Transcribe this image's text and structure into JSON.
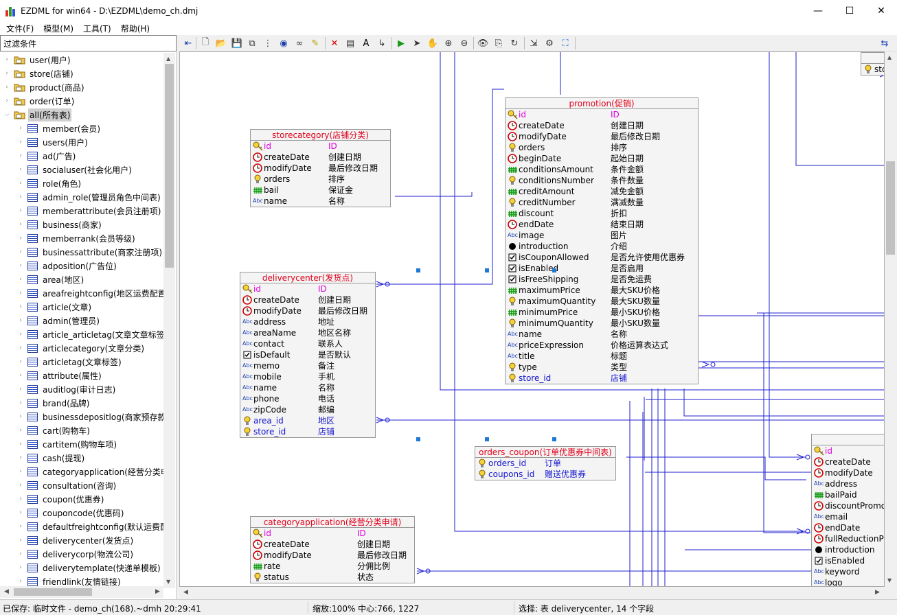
{
  "window": {
    "title": "EZDML for win64 - D:\\EZDML\\demo_ch.dmj",
    "min": "—",
    "max": "☐",
    "close": "✕"
  },
  "menu": [
    "文件(F)",
    "模型(M)",
    "工具(T)",
    "帮助(H)"
  ],
  "filter": {
    "label": "过滤条件"
  },
  "tree": {
    "groups": [
      "user(用户)",
      "store(店铺)",
      "product(商品)",
      "order(订单)",
      "all(所有表)"
    ],
    "tables": [
      "member(会员)",
      "users(用户)",
      "ad(广告)",
      "socialuser(社会化用户)",
      "role(角色)",
      "admin_role(管理员角色中间表)",
      "memberattribute(会员注册项)",
      "business(商家)",
      "memberrank(会员等级)",
      "businessattribute(商家注册项)",
      "adposition(广告位)",
      "area(地区)",
      "areafreightconfig(地区运费配置",
      "article(文章)",
      "admin(管理员)",
      "article_articletag(文章文章标签中",
      "articlecategory(文章分类)",
      "articletag(文章标签)",
      "attribute(属性)",
      "auditlog(审计日志)",
      "brand(品牌)",
      "businessdepositlog(商家预存款",
      "cart(购物车)",
      "cartitem(购物车项)",
      "cash(提现)",
      "categoryapplication(经营分类申",
      "consultation(咨询)",
      "coupon(优惠券)",
      "couponcode(优惠码)",
      "defaultfreightconfig(默认运费配",
      "deliverycenter(发货点)",
      "deliverycorp(物流公司)",
      "deliverytemplate(快递单模板)",
      "friendlink(友情链接)"
    ]
  },
  "toolbar_icons": [
    "back-icon",
    "new-icon",
    "open-icon",
    "save-icon",
    "copy-icon",
    "tree-icon",
    "globe-icon",
    "find-icon",
    "highlight-icon",
    "delete-icon",
    "table-icon",
    "text-icon",
    "link-icon",
    "run-icon",
    "pointer-icon",
    "hand-icon",
    "zoom-in-icon",
    "zoom-out-icon",
    "preview-icon",
    "export-icon",
    "refresh-icon",
    "import-icon",
    "settings-icon",
    "fit-icon"
  ],
  "entities": {
    "storecategory": {
      "title": "storecategory(店铺分类)",
      "fields": [
        [
          "key",
          "id",
          "ID",
          "pk"
        ],
        [
          "clock",
          "createDate",
          "创建日期",
          ""
        ],
        [
          "clock",
          "modifyDate",
          "最后修改日期",
          ""
        ],
        [
          "bulb",
          "orders",
          "排序",
          ""
        ],
        [
          "hash",
          "bail",
          "保证金",
          ""
        ],
        [
          "abc",
          "name",
          "名称",
          ""
        ]
      ]
    },
    "deliverycenter": {
      "title": "deliverycenter(发货点)",
      "fields": [
        [
          "key",
          "id",
          "ID",
          "pk"
        ],
        [
          "clock",
          "createDate",
          "创建日期",
          ""
        ],
        [
          "clock",
          "modifyDate",
          "最后修改日期",
          ""
        ],
        [
          "abc",
          "address",
          "地址",
          ""
        ],
        [
          "abc",
          "areaName",
          "地区名称",
          ""
        ],
        [
          "abc",
          "contact",
          "联系人",
          ""
        ],
        [
          "check",
          "isDefault",
          "是否默认",
          ""
        ],
        [
          "abc",
          "memo",
          "备注",
          ""
        ],
        [
          "abc",
          "mobile",
          "手机",
          ""
        ],
        [
          "abc",
          "name",
          "名称",
          ""
        ],
        [
          "abc",
          "phone",
          "电话",
          ""
        ],
        [
          "abc",
          "zipCode",
          "邮编",
          ""
        ],
        [
          "bulb",
          "area_id",
          "地区",
          "fk"
        ],
        [
          "bulb",
          "store_id",
          "店铺",
          "fk"
        ]
      ]
    },
    "promotion": {
      "title": "promotion(促销)",
      "fields": [
        [
          "key",
          "id",
          "ID",
          "pk"
        ],
        [
          "clock",
          "createDate",
          "创建日期",
          ""
        ],
        [
          "clock",
          "modifyDate",
          "最后修改日期",
          ""
        ],
        [
          "bulb",
          "orders",
          "排序",
          ""
        ],
        [
          "clock",
          "beginDate",
          "起始日期",
          ""
        ],
        [
          "hash",
          "conditionsAmount",
          "条件金额",
          ""
        ],
        [
          "bulb",
          "conditionsNumber",
          "条件数量",
          ""
        ],
        [
          "hash",
          "creditAmount",
          "减免金额",
          ""
        ],
        [
          "bulb",
          "creditNumber",
          "满减数量",
          ""
        ],
        [
          "hash",
          "discount",
          "折扣",
          ""
        ],
        [
          "clock",
          "endDate",
          "结束日期",
          ""
        ],
        [
          "abc",
          "image",
          "图片",
          ""
        ],
        [
          "dot",
          "introduction",
          "介绍",
          ""
        ],
        [
          "check",
          "isCouponAllowed",
          "是否允许使用优惠券",
          ""
        ],
        [
          "check",
          "isEnabled",
          "是否启用",
          ""
        ],
        [
          "check",
          "isFreeShipping",
          "是否免运费",
          ""
        ],
        [
          "hash",
          "maximumPrice",
          "最大SKU价格",
          ""
        ],
        [
          "bulb",
          "maximumQuantity",
          "最大SKU数量",
          ""
        ],
        [
          "hash",
          "minimumPrice",
          "最小SKU价格",
          ""
        ],
        [
          "bulb",
          "minimumQuantity",
          "最小SKU数量",
          ""
        ],
        [
          "abc",
          "name",
          "名称",
          ""
        ],
        [
          "abc",
          "priceExpression",
          "价格运算表达式",
          ""
        ],
        [
          "abc",
          "title",
          "标题",
          ""
        ],
        [
          "bulb",
          "type",
          "类型",
          ""
        ],
        [
          "bulb",
          "store_id",
          "店铺",
          "fk"
        ]
      ]
    },
    "orders_coupon": {
      "title": "orders_coupon(订单优惠券中间表)",
      "fields": [
        [
          "bulb",
          "orders_id",
          "订单",
          "fk"
        ],
        [
          "bulb",
          "coupons_id",
          "赠送优惠券",
          "fk"
        ]
      ]
    },
    "categoryapplication": {
      "title": "categoryapplication(经营分类申请)",
      "fields": [
        [
          "key",
          "id",
          "ID",
          "pk"
        ],
        [
          "clock",
          "createDate",
          "创建日期",
          ""
        ],
        [
          "clock",
          "modifyDate",
          "最后修改日期",
          ""
        ],
        [
          "hash",
          "rate",
          "分佣比例",
          ""
        ],
        [
          "bulb",
          "status",
          "状态",
          ""
        ]
      ]
    },
    "store_partial": {
      "fields": [
        [
          "key",
          "id",
          "",
          "pk"
        ],
        [
          "clock",
          "createDate",
          "",
          ""
        ],
        [
          "clock",
          "modifyDate",
          "",
          ""
        ],
        [
          "abc",
          "address",
          "",
          ""
        ],
        [
          "hash",
          "bailPaid",
          "",
          ""
        ],
        [
          "clock",
          "discountPromo",
          "",
          ""
        ],
        [
          "abc",
          "email",
          "",
          ""
        ],
        [
          "clock",
          "endDate",
          "",
          ""
        ],
        [
          "clock",
          "fullReductionPr",
          "",
          ""
        ],
        [
          "dot",
          "introduction",
          "",
          ""
        ],
        [
          "check",
          "isEnabled",
          "",
          ""
        ],
        [
          "abc",
          "keyword",
          "",
          ""
        ],
        [
          "abc",
          "logo",
          "",
          ""
        ]
      ]
    },
    "corner_partial": {
      "fields": [
        [
          "bulb",
          "sto",
          "",
          ""
        ]
      ]
    }
  },
  "status": {
    "saved": "已保存: 临时文件 - demo_ch(168).~dmh 20:29:41",
    "zoom": "缩放:100% 中心:766, 1227",
    "selection": "选择: 表 deliverycenter, 14 个字段"
  },
  "colors": {
    "title": "#e0001a",
    "pk": "#e000e0",
    "fk": "#1515d0",
    "line": "#1f1fd0"
  }
}
